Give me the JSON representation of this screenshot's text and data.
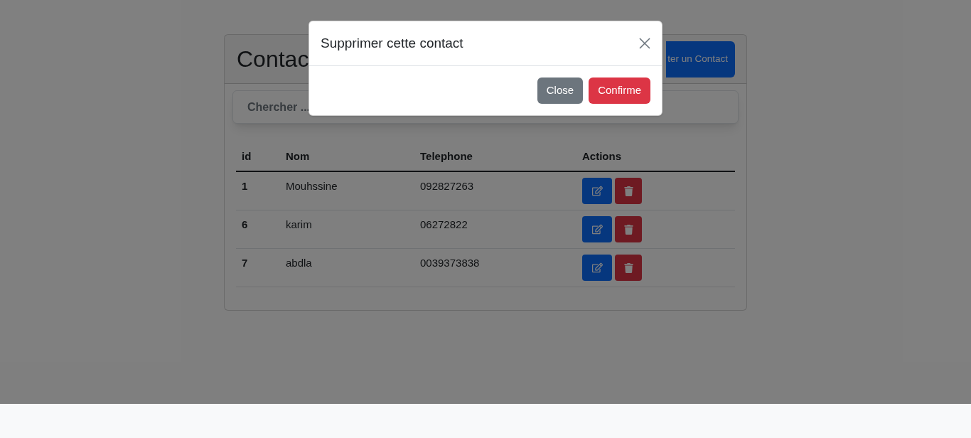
{
  "page": {
    "title": "Contac",
    "add_button": "ter un Contact",
    "search": {
      "placeholder": "Chercher ..."
    },
    "table": {
      "columns": [
        "id",
        "Nom",
        "Telephone",
        "Actions"
      ],
      "rows": [
        {
          "cells": [
            "1",
            "Mouhssine",
            "092827263"
          ]
        },
        {
          "cells": [
            "6",
            "karim",
            "06272822"
          ]
        },
        {
          "cells": [
            "7",
            "abdla",
            "0039373838"
          ]
        }
      ]
    }
  },
  "modal": {
    "title": "Supprimer cette contact",
    "buttons": [
      {
        "label": "Close",
        "kind": "secondary"
      },
      {
        "label": "Confirme",
        "kind": "danger"
      }
    ]
  }
}
